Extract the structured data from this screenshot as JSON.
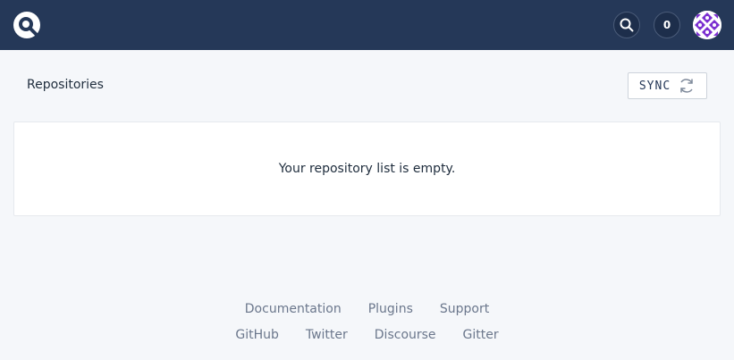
{
  "header": {
    "logo_icon": "drone-logo-icon",
    "search_icon": "search-icon",
    "builds_count": "0",
    "avatar_icon": "user-avatar"
  },
  "main": {
    "section_title": "Repositories",
    "sync_label": "SYNC",
    "sync_icon": "refresh-icon",
    "empty_message": "Your repository list is empty."
  },
  "footer": {
    "row1": [
      "Documentation",
      "Plugins",
      "Support"
    ],
    "row2": [
      "GitHub",
      "Twitter",
      "Discourse",
      "Gitter"
    ]
  },
  "colors": {
    "header_bg": "#253858",
    "page_bg": "#f5f7fa",
    "text": "#1f2d3d",
    "muted": "#6b778c",
    "avatar_accent": "#7b2fd0"
  }
}
